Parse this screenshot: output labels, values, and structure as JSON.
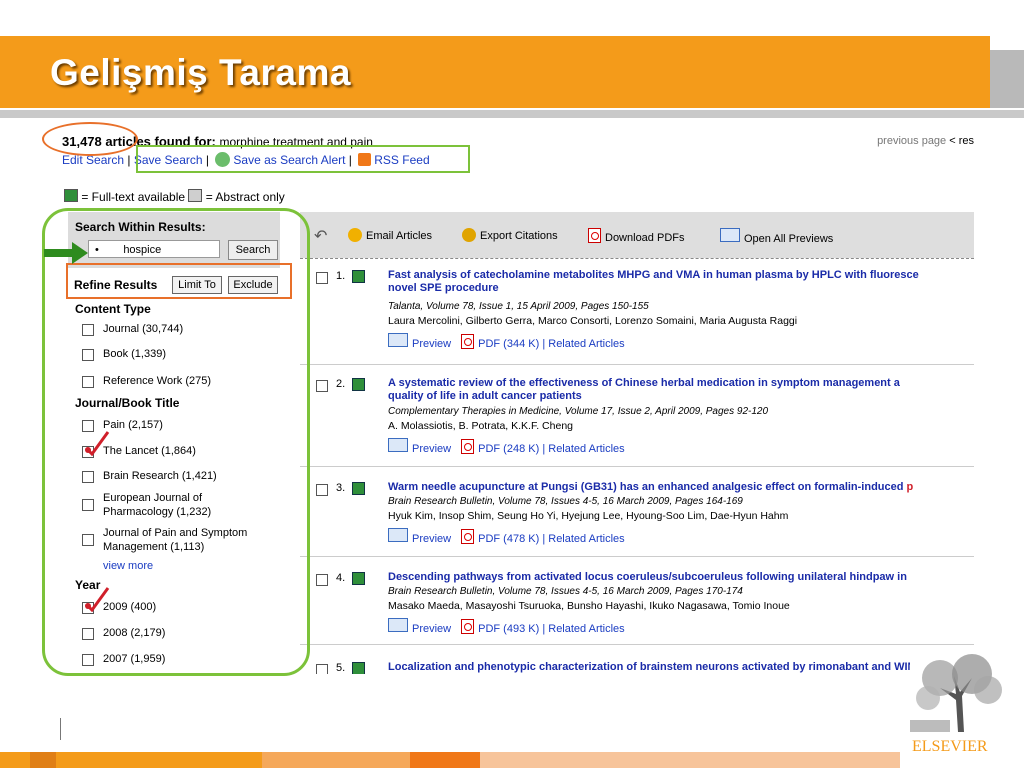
{
  "slide": {
    "title": "Gelişmiş Tarama"
  },
  "header": {
    "count": "31,478 articles found for:",
    "query": "morphine treatment and pain",
    "previous": "previous page",
    "rest": "< res",
    "links": [
      "Edit Search",
      "Save Search",
      "Save as Search Alert",
      "RSS Feed"
    ]
  },
  "legend": {
    "full": "= Full-text available",
    "abstract": "= Abstract only"
  },
  "sidebar": {
    "search_within_label": "Search Within Results:",
    "search_value": "hospice",
    "search_button": "Search",
    "refine_label": "Refine Results",
    "limit_button": "Limit To",
    "exclude_button": "Exclude",
    "content_type_heading": "Content Type",
    "content_type": [
      "Journal (30,744)",
      "Book (1,339)",
      "Reference Work (275)"
    ],
    "journal_heading": "Journal/Book Title",
    "journals": [
      "Pain (2,157)",
      "The Lancet (1,864)",
      "Brain Research (1,421)",
      "European Journal of Pharmacology (1,232)",
      "Journal of Pain and Symptom Management (1,113)"
    ],
    "view_more": "view more",
    "year_heading": "Year",
    "years": [
      "2009 (400)",
      "2008 (2,179)",
      "2007 (1,959)"
    ]
  },
  "toolbar": {
    "email": "Email Articles",
    "export": "Export Citations",
    "download": "Download PDFs",
    "previews": "Open All Previews"
  },
  "results": [
    {
      "num": "1.",
      "title1": "Fast analysis of catecholamine metabolites MHPG and VMA in human plasma by HPLC with fluoresce",
      "title2": "novel SPE procedure",
      "journal": "Talanta, Volume 78, Issue 1, 15 April 2009, Pages 150-155",
      "authors": "Laura Mercolini, Gilberto Gerra, Marco Consorti, Lorenzo Somaini, Maria Augusta Raggi",
      "pdf": "PDF (344 K)"
    },
    {
      "num": "2.",
      "title1": "A systematic review of the effectiveness of Chinese herbal medication in symptom management a",
      "title2": "quality of life in adult cancer patients",
      "journal": "Complementary Therapies in Medicine, Volume 17, Issue 2, April 2009, Pages 92-120",
      "authors": "A. Molassiotis, B. Potrata, K.K.F. Cheng",
      "pdf": "PDF (248 K)"
    },
    {
      "num": "3.",
      "title1": "Warm needle acupuncture at Pungsi (GB31) has an enhanced analgesic effect on formalin-induced",
      "title2_red": "p",
      "journal": "Brain Research Bulletin, Volume 78, Issues 4-5, 16 March 2009, Pages 164-169",
      "authors": "Hyuk Kim, Insop Shim, Seung Ho Yi, Hyejung Lee, Hyoung-Soo Lim, Dae-Hyun Hahm",
      "pdf": "PDF (478 K)"
    },
    {
      "num": "4.",
      "title1": "Descending pathways from activated locus coeruleus/subcoeruleus following unilateral hindpaw in",
      "journal": "Brain Research Bulletin, Volume 78, Issues 4-5, 16 March 2009, Pages 170-174",
      "authors": "Masako Maeda, Masayoshi Tsuruoka, Bunsho Hayashi, Ikuko Nagasawa, Tomio Inoue",
      "pdf": "PDF (493 K)"
    },
    {
      "num": "5.",
      "title1": "Localization and phenotypic characterization of brainstem neurons activated by rimonabant and WIN"
    }
  ],
  "result_links": {
    "preview": "Preview",
    "related": "Related Articles"
  },
  "logo": {
    "text": "ELSEVIER"
  },
  "colors": {
    "orange": "#f49b1a",
    "green_annotation": "#7cc23a",
    "orange_annotation": "#e8702a"
  }
}
